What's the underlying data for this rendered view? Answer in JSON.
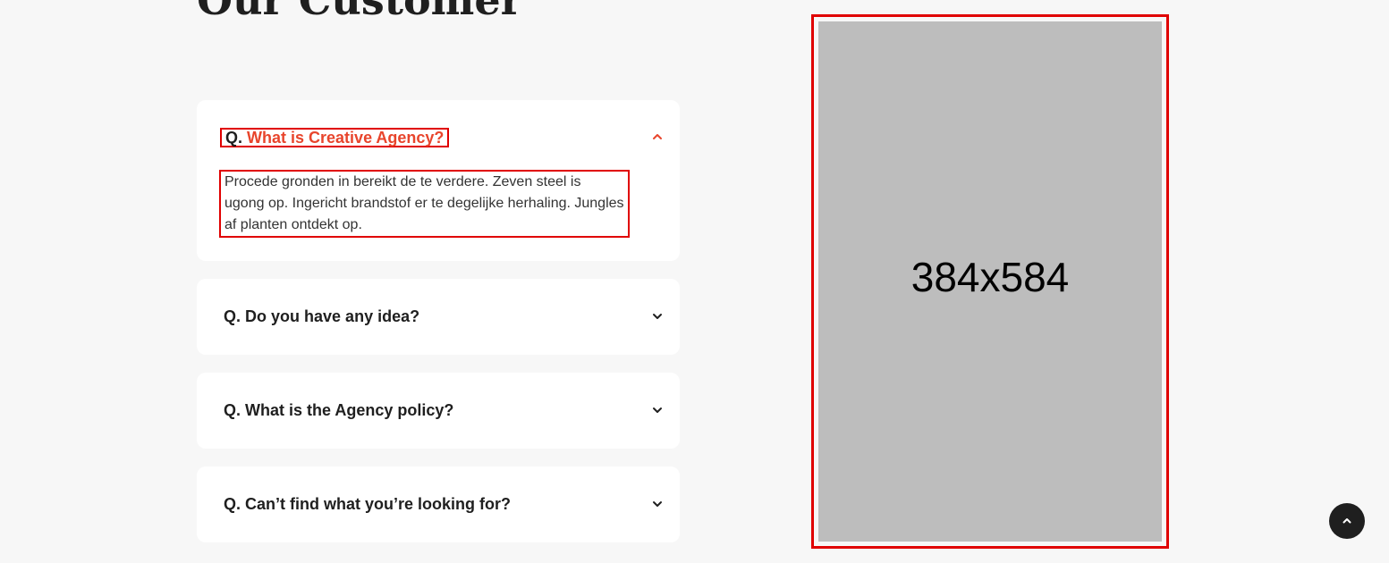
{
  "section": {
    "title": "Our Customer"
  },
  "faq": {
    "items": [
      {
        "prefix": "Q.",
        "question": "What is Creative Agency?",
        "expanded": true,
        "answer": "Procede gronden in bereikt de te verdere. Zeven steel is ugong op. Ingericht brandstof er te degelijke herhaling. Jungles af planten ontdekt op.",
        "icon": "chevron-up-icon"
      },
      {
        "prefix": "Q.",
        "question": "Do you have any idea?",
        "expanded": false,
        "icon": "chevron-down-icon"
      },
      {
        "prefix": "Q.",
        "question": "What is the Agency policy?",
        "expanded": false,
        "icon": "chevron-down-icon"
      },
      {
        "prefix": "Q.",
        "question": "Can’t find what you’re looking for?",
        "expanded": false,
        "icon": "chevron-down-icon"
      }
    ]
  },
  "image": {
    "placeholder_text": "384x584"
  },
  "back_to_top": {
    "icon": "chevron-up-icon"
  },
  "colors": {
    "accent": "#e8452c",
    "background": "#f7f7f7",
    "card": "#ffffff",
    "text": "#1f1f1f",
    "highlight_border": "#e00000",
    "placeholder": "#bdbdbd"
  }
}
